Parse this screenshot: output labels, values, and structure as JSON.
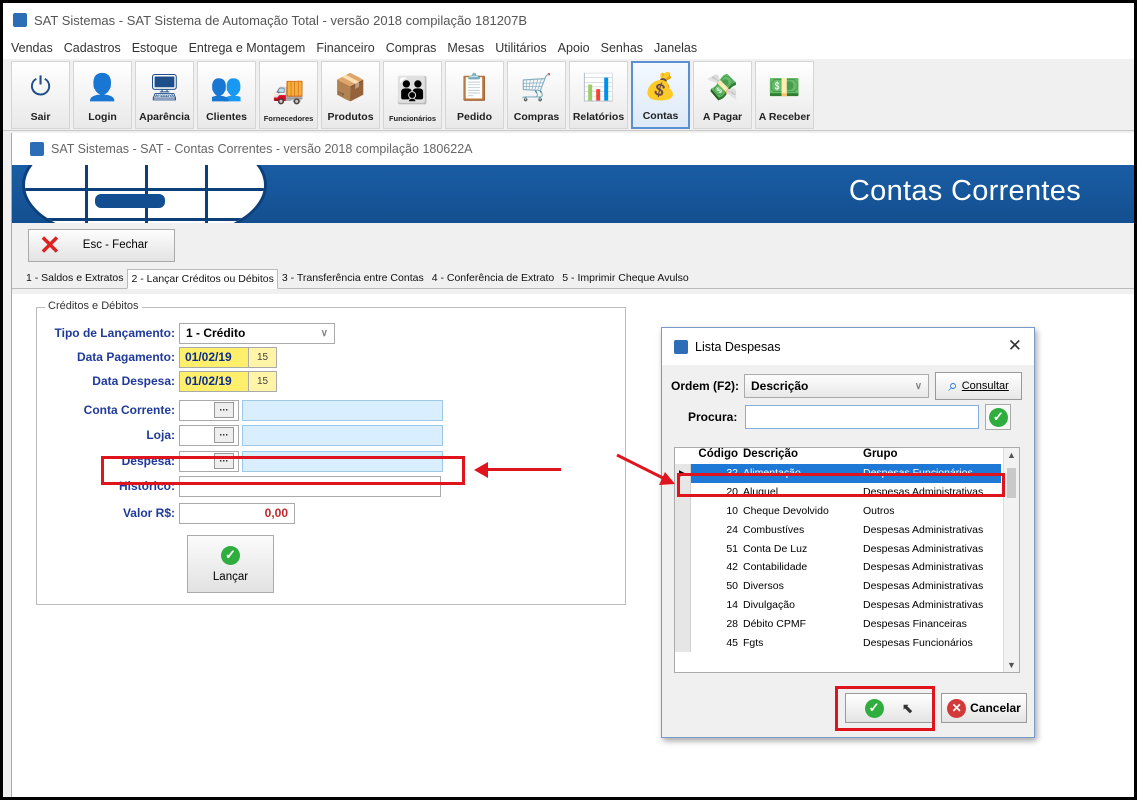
{
  "app": {
    "title": "SAT Sistemas - SAT Sistema de Automação Total - versão 2018 compilação 181207B"
  },
  "menu": [
    "Vendas",
    "Cadastros",
    "Estoque",
    "Entrega e Montagem",
    "Financeiro",
    "Compras",
    "Mesas",
    "Utilitários",
    "Apoio",
    "Senhas",
    "Janelas"
  ],
  "toolbar": [
    {
      "label": "Sair",
      "icon": "power-icon",
      "glyph": "⏻",
      "small": false
    },
    {
      "label": "Login",
      "icon": "user-login-icon",
      "glyph": "👤",
      "small": false
    },
    {
      "label": "Aparência",
      "icon": "monitor-icon",
      "glyph": "🖥",
      "small": false
    },
    {
      "label": "Clientes",
      "icon": "clients-icon",
      "glyph": "👥",
      "small": false
    },
    {
      "label": "Fornecedores",
      "icon": "truck-icon",
      "glyph": "🚚",
      "small": true
    },
    {
      "label": "Produtos",
      "icon": "boxes-icon",
      "glyph": "📦",
      "small": false
    },
    {
      "label": "Funcionários",
      "icon": "staff-icon",
      "glyph": "👪",
      "small": true
    },
    {
      "label": "Pedido",
      "icon": "order-icon",
      "glyph": "📋",
      "small": false
    },
    {
      "label": "Compras",
      "icon": "cart-icon",
      "glyph": "🛒",
      "small": false
    },
    {
      "label": "Relatórios",
      "icon": "report-chart-icon",
      "glyph": "📊",
      "small": false
    },
    {
      "label": "Contas",
      "icon": "coins-icon",
      "glyph": "💰",
      "small": false,
      "active": true
    },
    {
      "label": "A Pagar",
      "icon": "pay-icon",
      "glyph": "💸",
      "small": false
    },
    {
      "label": "A Receber",
      "icon": "receive-icon",
      "glyph": "💵",
      "small": false
    }
  ],
  "window": {
    "title": "SAT Sistemas - SAT - Contas Correntes - versão 2018 compilação 180622A",
    "banner_title": "Contas Correntes",
    "close_button": "Esc - Fechar"
  },
  "tabs": [
    "1 - Saldos e Extratos",
    "2 - Lançar Créditos ou Débitos",
    "3 - Transferência entre Contas",
    "4 - Conferência de Extrato",
    "5 - Imprimir Cheque Avulso"
  ],
  "form": {
    "group_title": "Créditos e Débitos",
    "tipo_label": "Tipo de Lançamento:",
    "tipo_value": "1 - Crédito",
    "data_pag_label": "Data Pagamento:",
    "data_pag_value": "01/02/19",
    "data_desp_label": "Data Despesa:",
    "data_desp_value": "01/02/19",
    "conta_label": "Conta Corrente:",
    "loja_label": "Loja:",
    "despesa_label": "Despesa:",
    "historico_label": "Histórico:",
    "valor_label": "Valor R$:",
    "valor_value": "0,00",
    "lancar_label": "Lançar",
    "dots": "···",
    "cal": "15"
  },
  "dialog": {
    "title": "Lista Despesas",
    "order_label": "Ordem (F2):",
    "order_value": "Descrição",
    "consult_label": "Consultar",
    "search_label": "Procura:",
    "search_value": "",
    "columns": [
      "Código",
      "Descrição",
      "Grupo"
    ],
    "rows": [
      {
        "code": "32",
        "desc": "Alimentação",
        "group": "Despesas Funcionários"
      },
      {
        "code": "20",
        "desc": "Aluguel",
        "group": "Despesas Administrativas"
      },
      {
        "code": "10",
        "desc": "Cheque Devolvido",
        "group": "Outros"
      },
      {
        "code": "24",
        "desc": "Combustíves",
        "group": "Despesas Administrativas"
      },
      {
        "code": "51",
        "desc": "Conta De Luz",
        "group": "Despesas Administrativas"
      },
      {
        "code": "42",
        "desc": "Contabilidade",
        "group": "Despesas Administrativas"
      },
      {
        "code": "50",
        "desc": "Diversos",
        "group": "Despesas Administrativas"
      },
      {
        "code": "14",
        "desc": "Divulgação",
        "group": "Despesas Administrativas"
      },
      {
        "code": "28",
        "desc": "Débito CPMF",
        "group": "Despesas Financeiras"
      },
      {
        "code": "45",
        "desc": "Fgts",
        "group": "Despesas Funcionários"
      }
    ],
    "cancel_label": "Cancelar"
  },
  "colors": {
    "banner": "#1a5da4",
    "highlight": "#e0141c",
    "selection": "#1e79d6",
    "label_blue": "#1f3a9a"
  }
}
